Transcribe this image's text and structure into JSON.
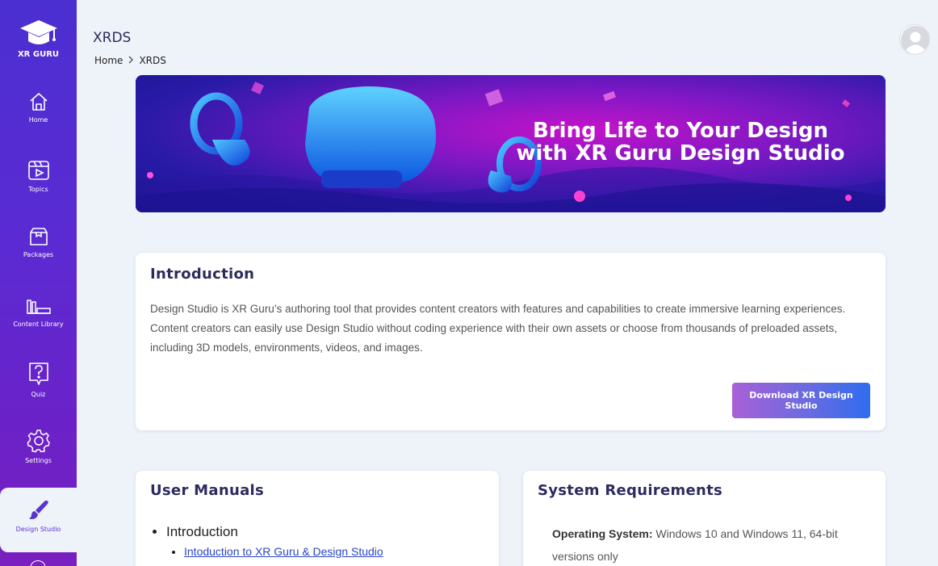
{
  "app": {
    "logo_text": "XR GURU"
  },
  "sidebar": {
    "items": [
      {
        "label": "Home",
        "icon": "home-icon"
      },
      {
        "label": "Topics",
        "icon": "video-icon"
      },
      {
        "label": "Packages",
        "icon": "box-icon"
      },
      {
        "label": "Content Library",
        "icon": "library-icon"
      },
      {
        "label": "Quiz",
        "icon": "question-icon"
      },
      {
        "label": "Settings",
        "icon": "gear-icon"
      },
      {
        "label": "Design Studio",
        "icon": "brush-icon",
        "active": true
      }
    ]
  },
  "header": {
    "title": "XRDS",
    "breadcrumb": [
      {
        "label": "Home"
      },
      {
        "label": "XRDS"
      }
    ],
    "breadcrumb_separator": ">"
  },
  "banner": {
    "heading_line1": "Bring Life to Your Design",
    "heading_line2": "with XR Guru Design Studio"
  },
  "intro": {
    "title": "Introduction",
    "body": "Design Studio is XR Guru’s authoring tool that provides content creators with features and capabilities to create immersive learning experiences. Content creators can easily use Design Studio without coding experience with their own assets or choose from thousands of preloaded assets, including 3D models, environments, videos, and images.",
    "download_label": "Download XR Design Studio"
  },
  "manuals": {
    "title": "User Manuals",
    "items": [
      {
        "label": "Introduction",
        "children": [
          {
            "label": "Intoduction to XR Guru & Design Studio"
          }
        ]
      }
    ]
  },
  "sysreq": {
    "title": "System Requirements",
    "os_label": "Operating System:",
    "os_value": " Windows 10 and Windows 11, 64-bit versions only"
  },
  "colors": {
    "sidebar_top": "#4b2fd1",
    "sidebar_bottom": "#7a1fc0",
    "title_text": "#2c2b5e",
    "link": "#2a45c8",
    "background": "#eef2f9"
  }
}
